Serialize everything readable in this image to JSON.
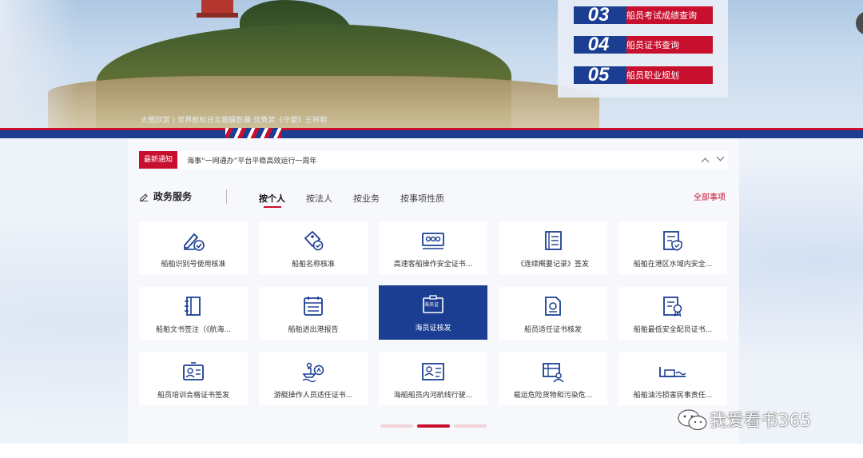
{
  "banner": {
    "caption": "大图欣赏 | 世界航标日主题摄影展 优秀奖《守望》王祥明",
    "quick_links": [
      {
        "num": "03",
        "label": "船员考试成绩查询"
      },
      {
        "num": "04",
        "label": "船员证书查询"
      },
      {
        "num": "05",
        "label": "船员职业规划"
      }
    ]
  },
  "notice": {
    "badge": "最新通知",
    "text": "海事“一网通办”平台平稳高效运行一周年"
  },
  "services": {
    "title": "政务服务",
    "tabs": [
      "按个人",
      "按法人",
      "按业务",
      "按事项性质"
    ],
    "active_tab": "按个人",
    "all_link": "全部事项",
    "items": [
      {
        "label": "船舶识别号使用核准",
        "icon": "pen-check-icon"
      },
      {
        "label": "船舶名称核准",
        "icon": "tag-check-icon"
      },
      {
        "label": "高速客船操作安全证书...",
        "icon": "high-speed-boat-icon"
      },
      {
        "label": "《连续概要记录》签发",
        "icon": "record-book-icon"
      },
      {
        "label": "船舶在港区水域内安全...",
        "icon": "shield-doc-icon"
      },
      {
        "label": "船舶文书签注（《航海...",
        "icon": "ledger-icon"
      },
      {
        "label": "船舶进出港报告",
        "icon": "calendar-report-icon"
      },
      {
        "label": "海员证核发",
        "icon": "seaman-card-icon",
        "badge": "海员证"
      },
      {
        "label": "船员适任证书核发",
        "icon": "certificate-doc-icon"
      },
      {
        "label": "船舶最低安全配员证书...",
        "icon": "award-doc-icon"
      },
      {
        "label": "船员培训合格证书签发",
        "icon": "id-card-icon"
      },
      {
        "label": "游艇操作人员适任证书...",
        "icon": "yacht-icon"
      },
      {
        "label": "海船船员内河航线行驶...",
        "icon": "crew-card-icon"
      },
      {
        "label": "载运危险货物和污染危...",
        "icon": "cargo-person-icon"
      },
      {
        "label": "船舶油污损害民事责任...",
        "icon": "oil-ship-icon"
      }
    ]
  },
  "watermark": "我爱看书365",
  "colors": {
    "brand_blue": "#1b3e93",
    "brand_red": "#c8102e"
  }
}
